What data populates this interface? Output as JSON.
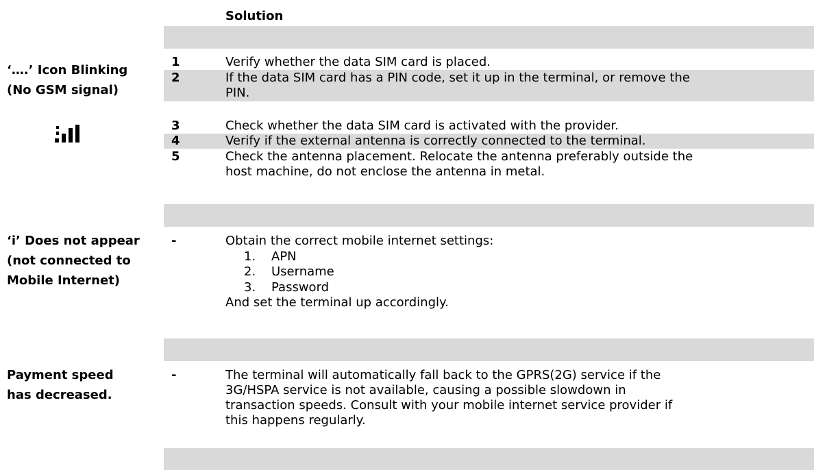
{
  "header": {
    "solution": "Solution"
  },
  "sections": [
    {
      "problem_lines": [
        "‘….’ Icon Blinking",
        "(No GSM signal)"
      ],
      "icon": "signal-strength-icon",
      "steps": [
        {
          "num": "1",
          "lines": [
            "Verify whether the data SIM card is placed."
          ]
        },
        {
          "num": "2",
          "lines": [
            "If the data SIM card has a PIN code, set it up in the terminal, or remove the",
            "PIN."
          ]
        },
        {
          "num": "3",
          "lines": [
            "Check whether the data SIM card is activated with the provider."
          ]
        },
        {
          "num": "4",
          "lines": [
            "Verify if the external antenna is correctly connected to the terminal."
          ]
        },
        {
          "num": "5",
          "lines": [
            "Check the antenna placement. Relocate the antenna preferably outside the",
            "host machine, do not enclose the antenna in metal."
          ]
        }
      ]
    },
    {
      "problem_lines": [
        "‘i’ Does not appear",
        "(not connected to",
        "Mobile Internet)"
      ],
      "marker": "-",
      "intro": "Obtain the correct mobile internet settings:",
      "list": [
        {
          "n": "1.",
          "label": "APN"
        },
        {
          "n": "2.",
          "label": "Username"
        },
        {
          "n": "3.",
          "label": "Password"
        }
      ],
      "outro": "And set the terminal up accordingly."
    },
    {
      "problem_lines": [
        "Payment speed",
        "has decreased."
      ],
      "marker": "-",
      "lines": [
        "The terminal will automatically fall back to the GPRS(2G) service if the",
        "3G/HSPA service is not available, causing a possible slowdown in",
        "transaction speeds. Consult with your mobile internet service provider if",
        "this happens regularly."
      ]
    }
  ],
  "colors": {
    "band": "#d9d9d9",
    "text": "#000000"
  }
}
